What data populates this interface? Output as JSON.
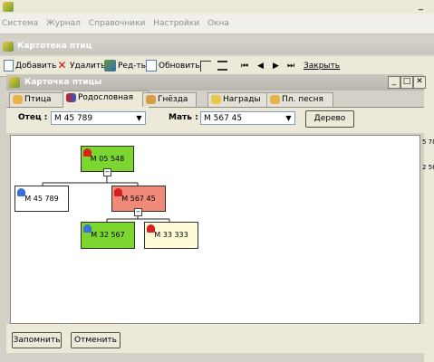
{
  "app": {
    "title_icon": "pencil-app-icon"
  },
  "menu": {
    "items": [
      "Система",
      "Журнал",
      "Справочники",
      "Настройки",
      "Окна"
    ]
  },
  "card_window": {
    "title": "Картотека птиц"
  },
  "toolbar": {
    "add_label": "Добавить",
    "delete_label": "Удалить",
    "edit_label": "Ред-ть",
    "refresh_label": "Обновить",
    "close_label": "Закрыть"
  },
  "inner_window": {
    "title": "Карточка птицы"
  },
  "tabs": [
    {
      "label": "Птица"
    },
    {
      "label": "Родословная"
    },
    {
      "label": "Гнёзда"
    },
    {
      "label": "Награды"
    },
    {
      "label": "Пл. песня"
    }
  ],
  "form": {
    "father_label": "Отец :",
    "father_value": "М 45 789",
    "mother_label": "Мать :",
    "mother_value": "М 567 45",
    "tree_button": "Дерево"
  },
  "tree": {
    "root": "М 05 548",
    "father": "М 45 789",
    "mother": "М 567 45",
    "child_1": "М 32 567",
    "child_2": "М 33 333"
  },
  "colors": {
    "node_green": "#7dd630",
    "node_salmon": "#f08a78",
    "node_white": "#ffffff",
    "node_cream": "#fffbd6"
  },
  "buttons": {
    "save_label": "Запомнить",
    "cancel_label": "Отменить"
  },
  "side_peek": {
    "value_1": "5 78",
    "value_2": "2 56"
  }
}
